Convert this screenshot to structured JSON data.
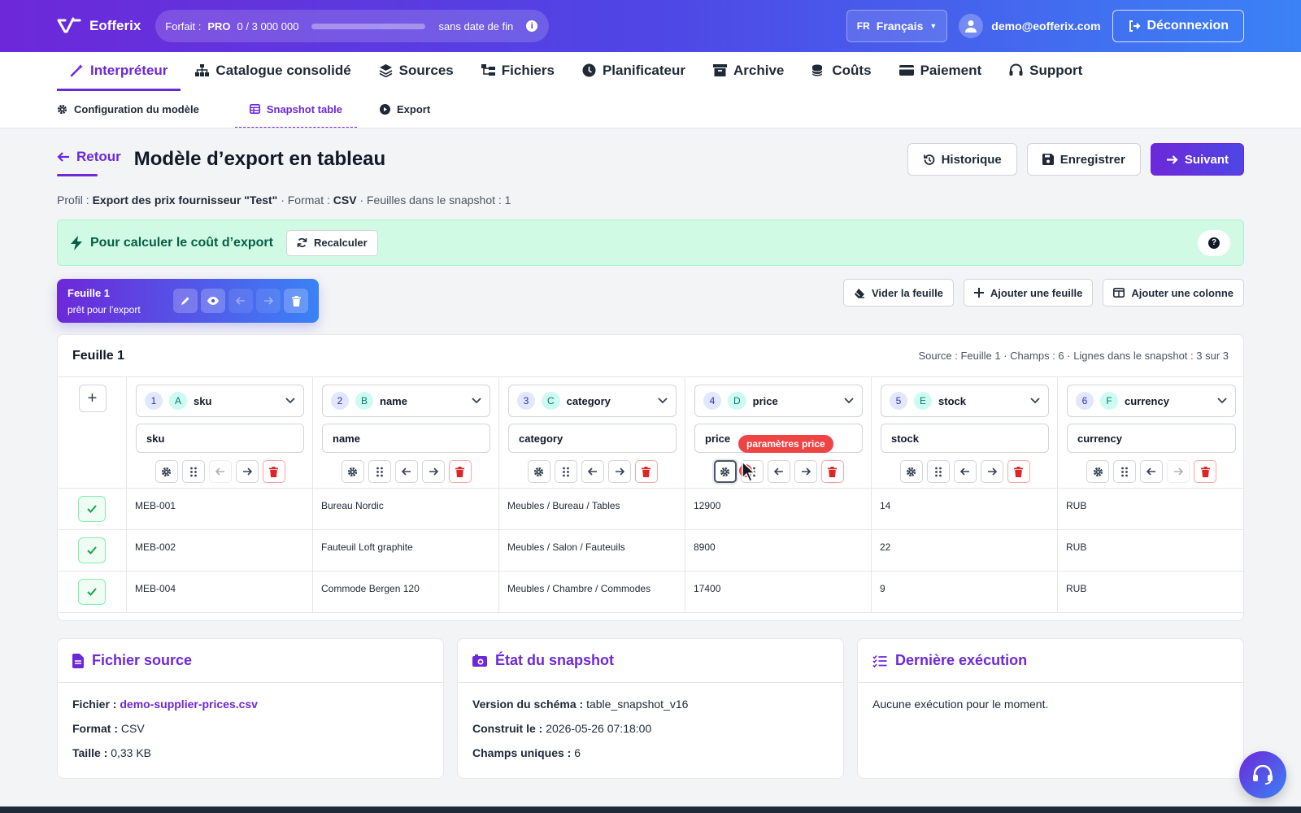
{
  "topbar": {
    "app_name": "Eofferix",
    "plan_label": "Forfait :",
    "plan_name": "PRO",
    "plan_usage": "0 / 3 000 000",
    "plan_progress": 0,
    "plan_end": "sans date de fin",
    "lang_code": "FR",
    "lang_name": "Français",
    "user_email": "demo@eofferix.com",
    "logout_label": "Déconnexion"
  },
  "nav": {
    "items": [
      {
        "label": "Interpréteur",
        "icon": "magic-wand-icon",
        "active": true
      },
      {
        "label": "Catalogue consolidé",
        "icon": "sitemap-icon"
      },
      {
        "label": "Sources",
        "icon": "layers-icon"
      },
      {
        "label": "Fichiers",
        "icon": "folder-tree-icon"
      },
      {
        "label": "Planificateur",
        "icon": "clock-icon"
      },
      {
        "label": "Archive",
        "icon": "archive-icon"
      },
      {
        "label": "Coûts",
        "icon": "coins-icon"
      },
      {
        "label": "Paiement",
        "icon": "credit-card-icon"
      },
      {
        "label": "Support",
        "icon": "headset-icon"
      }
    ]
  },
  "subnav": {
    "items": [
      {
        "label": "Configuration du modèle",
        "icon": "gear-icon"
      },
      {
        "label": "Snapshot table",
        "icon": "table-icon",
        "active": true
      },
      {
        "label": "Export",
        "icon": "play-circle-icon"
      }
    ]
  },
  "page": {
    "back_label": "Retour",
    "title": "Modèle d’export en tableau",
    "history_label": "Historique",
    "save_label": "Enregistrer",
    "next_label": "Suivant",
    "profile_prefix": "Profil :",
    "profile_name": "Export des prix fournisseur \"Test\"",
    "format_prefix": "· Format :",
    "format_value": "CSV",
    "sheets_text": "· Feuilles dans le snapshot : 1"
  },
  "alert": {
    "text": "Pour calculer le coût d’export",
    "recalc_label": "Recalculer",
    "help_symbol": "?"
  },
  "sheet_tab": {
    "name": "Feuille 1",
    "status": "prêt pour l'export"
  },
  "sheet_actions": {
    "clear_label": "Vider la feuille",
    "add_sheet_label": "Ajouter une feuille",
    "add_column_label": "Ajouter une colonne"
  },
  "table": {
    "title": "Feuille 1",
    "meta": "Source : Feuille 1 · Champs : 6 · Lignes dans le snapshot : 3 sur 3",
    "add_symbol": "+",
    "columns": [
      {
        "num": "1",
        "letter": "A",
        "field": "sku",
        "header": "sku"
      },
      {
        "num": "2",
        "letter": "B",
        "field": "name",
        "header": "name"
      },
      {
        "num": "3",
        "letter": "C",
        "field": "category",
        "header": "category"
      },
      {
        "num": "4",
        "letter": "D",
        "field": "price",
        "header": "price"
      },
      {
        "num": "5",
        "letter": "E",
        "field": "stock",
        "header": "stock"
      },
      {
        "num": "6",
        "letter": "F",
        "field": "currency",
        "header": "currency"
      }
    ],
    "rows": [
      [
        "MEB-001",
        "Bureau Nordic",
        "Meubles / Bureau / Tables",
        "12900",
        "14",
        "RUB"
      ],
      [
        "MEB-002",
        "Fauteuil Loft graphite",
        "Meubles / Salon / Fauteuils",
        "8900",
        "22",
        "RUB"
      ],
      [
        "MEB-004",
        "Commode Bergen 120",
        "Meubles / Chambre / Commodes",
        "17400",
        "9",
        "RUB"
      ]
    ],
    "tooltip": "paramètres price"
  },
  "source_card": {
    "title": "Fichier source",
    "file_label": "Fichier :",
    "file_value": "demo-supplier-prices.csv",
    "format_label": "Format :",
    "format_value": "CSV",
    "size_label": "Taille :",
    "size_value": "0,33 KB"
  },
  "snapshot_card": {
    "title": "État du snapshot",
    "schema_label": "Version du schéma :",
    "schema_value": "table_snapshot_v16",
    "built_label": "Construit le :",
    "built_value": "2026-05-26 07:18:00",
    "fields_label": "Champs uniques :",
    "fields_value": "6"
  },
  "exec_card": {
    "title": "Dernière exécution",
    "text": "Aucune exécution pour le moment."
  },
  "colors": {
    "brand": "#6d28d9",
    "accent": "#3b82f6",
    "success_bg": "#d1fae5",
    "danger": "#ef4444"
  }
}
